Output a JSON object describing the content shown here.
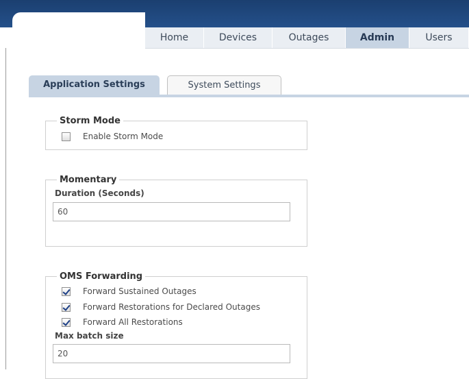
{
  "nav": {
    "items": [
      {
        "label": "Home",
        "active": false
      },
      {
        "label": "Devices",
        "active": false
      },
      {
        "label": "Outages",
        "active": false
      },
      {
        "label": "Admin",
        "active": true
      },
      {
        "label": "Users",
        "active": false
      }
    ]
  },
  "tabs": {
    "application": "Application Settings",
    "system": "System Settings"
  },
  "storm_mode": {
    "legend": "Storm Mode",
    "enable_label": "Enable Storm Mode",
    "enable_checked": false
  },
  "momentary": {
    "legend": "Momentary",
    "duration_label": "Duration (Seconds)",
    "duration_value": "60"
  },
  "oms": {
    "legend": "OMS Forwarding",
    "options": [
      {
        "label": "Forward Sustained Outages",
        "checked": true
      },
      {
        "label": "Forward Restorations for Declared Outages",
        "checked": true
      },
      {
        "label": "Forward All Restorations",
        "checked": true
      }
    ],
    "batch_label": "Max batch size",
    "batch_value": "20"
  },
  "colors": {
    "header": "#24508a",
    "active_tab": "#c7d4e3",
    "nav_bg": "#eaeef3"
  }
}
